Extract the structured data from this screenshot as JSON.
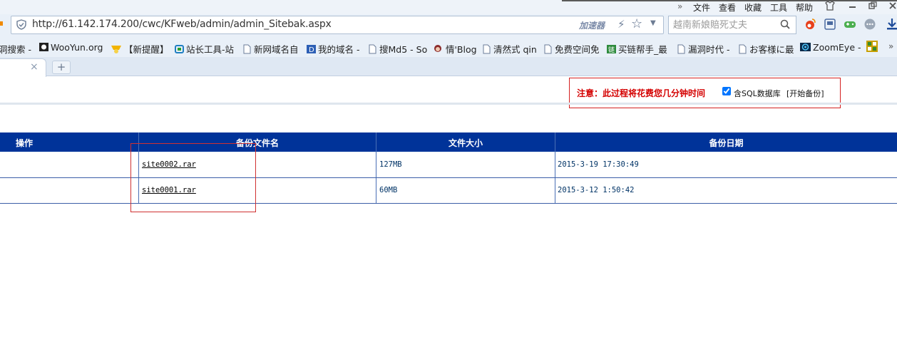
{
  "menu": {
    "chevrons": "»",
    "items": [
      "文件",
      "查看",
      "收藏",
      "工具",
      "帮助"
    ]
  },
  "address_bar": {
    "url": "http://61.142.174.200/cwc/KFweb/admin/admin_Sitebak.aspx",
    "accelerator_label": "加速器"
  },
  "search": {
    "placeholder": "越南新娘賠死丈夫"
  },
  "bookmarks": [
    {
      "label": "洞搜索 -",
      "icon": "none"
    },
    {
      "label": "WooYun.org",
      "icon": "wooyun-icon"
    },
    {
      "label": "【新提醒】",
      "icon": "medal-icon"
    },
    {
      "label": "站长工具-站",
      "icon": "site-tool-icon"
    },
    {
      "label": "新网域名自",
      "icon": "page-icon"
    },
    {
      "label": "我的域名 -",
      "icon": "d-icon"
    },
    {
      "label": "搜Md5 - So",
      "icon": "page-icon"
    },
    {
      "label": "情'Blog",
      "icon": "avatar-icon"
    },
    {
      "label": "清然式 qin",
      "icon": "page-icon"
    },
    {
      "label": "免费空间免",
      "icon": "page-icon"
    },
    {
      "label": "买链帮手_最",
      "icon": "link-icon"
    },
    {
      "label": "漏洞时代 -",
      "icon": "page-icon"
    },
    {
      "label": "お客様に最",
      "icon": "page-icon"
    },
    {
      "label": "ZoomEye -",
      "icon": "eye-icon"
    }
  ],
  "tabs": {
    "close_glyph": "×",
    "new_tab_glyph": "+"
  },
  "notice": {
    "warning_text": "注意：此过程将花费您几分钟时间",
    "checkbox_label": "含SQL数据库",
    "checkbox_checked": true,
    "start_link": "[开始备份]"
  },
  "table": {
    "headers": [
      "操作",
      "备份文件名",
      "文件大小",
      "备份日期"
    ],
    "rows": [
      {
        "action": "",
        "filename": "site0002.rar",
        "size": "127MB",
        "date": "2015-3-19 17:30:49"
      },
      {
        "action": "",
        "filename": "site0001.rar",
        "size": "60MB",
        "date": "2015-3-12 1:50:42"
      }
    ]
  },
  "colors": {
    "header_bg": "#003399",
    "warning_red": "#d40000",
    "highlight_box": "#d03030"
  }
}
